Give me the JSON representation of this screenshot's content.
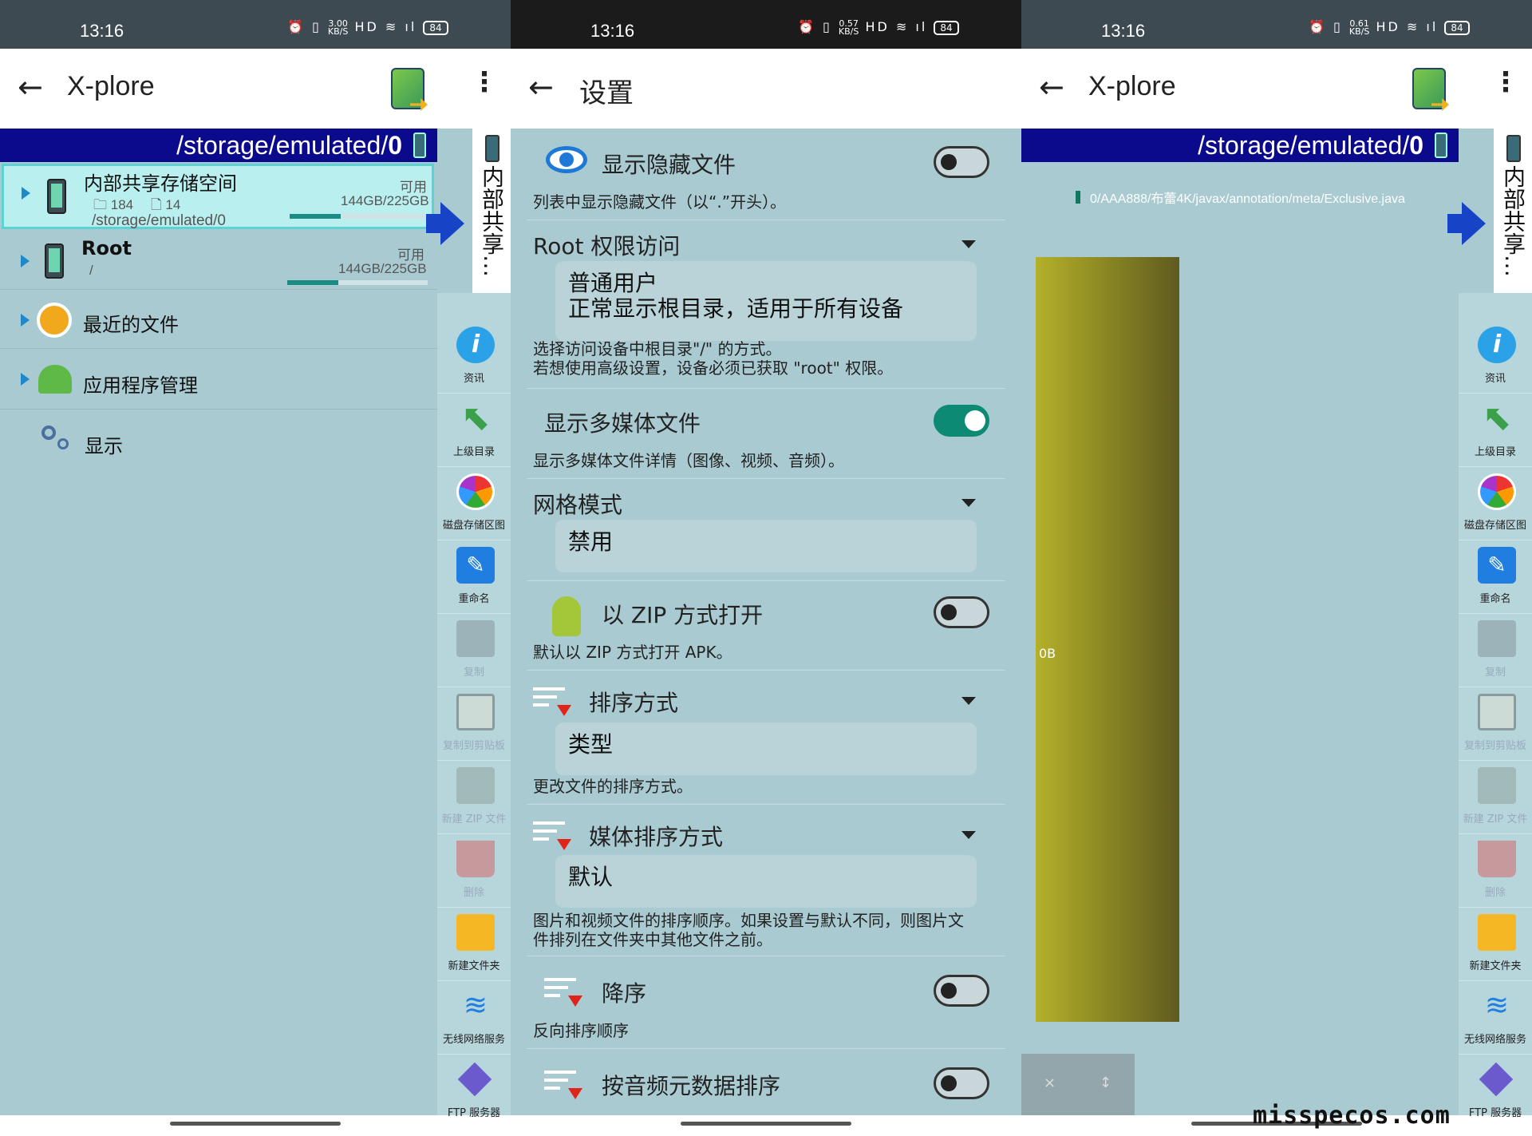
{
  "status_bar": {
    "time": "13:16",
    "battery": "84"
  },
  "panel1": {
    "title": "X-plore",
    "path": "/storage/emulated/",
    "path_bold": "0",
    "items": [
      {
        "name": "内部共享存储空间",
        "folders": "184",
        "files": "14",
        "sub": "/storage/emulated/0",
        "avail": "可用",
        "size": "144GB/225GB",
        "used": 0.36
      },
      {
        "name": "Root",
        "sub": "/",
        "avail": "可用",
        "size": "144GB/225GB",
        "used": 0.36
      },
      {
        "name": "最近的文件"
      },
      {
        "name": "应用程序管理"
      },
      {
        "name": "显示"
      }
    ]
  },
  "sidebar": {
    "vertical_label": "内部共享…",
    "tools": [
      "资讯",
      "上级目录",
      "磁盘存储区图",
      "重命名",
      "复制",
      "复制到剪贴板",
      "新建 ZIP 文件",
      "删除",
      "新建文件夹",
      "无线网络服务",
      "FTP 服务器"
    ]
  },
  "panel2": {
    "title": "设置",
    "s1": {
      "label": "显示隐藏文件",
      "desc": "列表中显示隐藏文件（以“.”开头）。"
    },
    "s2": {
      "label": "Root 权限访问",
      "value1": "普通用户",
      "value2": "正常显示根目录，适用于所有设备",
      "desc1": "选择访问设备中根目录\"/\" 的方式。",
      "desc2": "若想使用高级设置，设备必须已获取 \"root\" 权限。"
    },
    "s3": {
      "label": "显示多媒体文件",
      "desc": "显示多媒体文件详情（图像、视频、音频）。"
    },
    "s4": {
      "label": "网格模式",
      "value": "禁用"
    },
    "s5": {
      "label": "以 ZIP 方式打开",
      "desc": "默认以 ZIP 方式打开 APK。"
    },
    "s6": {
      "label": "排序方式",
      "value": "类型",
      "desc": "更改文件的排序方式。"
    },
    "s7": {
      "label": "媒体排序方式",
      "value": "默认",
      "desc1": "图片和视频文件的排序顺序。如果设置与默认不同，则图片文",
      "desc2": "件排列在文件夹中其他文件之前。"
    },
    "s8": {
      "label": "降序",
      "desc": "反向排序顺序"
    },
    "s9": {
      "label": "按音频元数据排序"
    }
  },
  "panel3": {
    "title": "X-plore",
    "path": "/storage/emulated/",
    "path_bold": "0",
    "file_path": "0/AAA888/布蕾4K/javax/annotation/meta/Exclusive.java",
    "size_label": "0B",
    "close": "×",
    "sort": "↕"
  },
  "watermark": "misspecos.com",
  "colors": {
    "accent": "#0b0a8c",
    "bg": "#a9cad1",
    "toggle_on": "#0d8a73"
  }
}
